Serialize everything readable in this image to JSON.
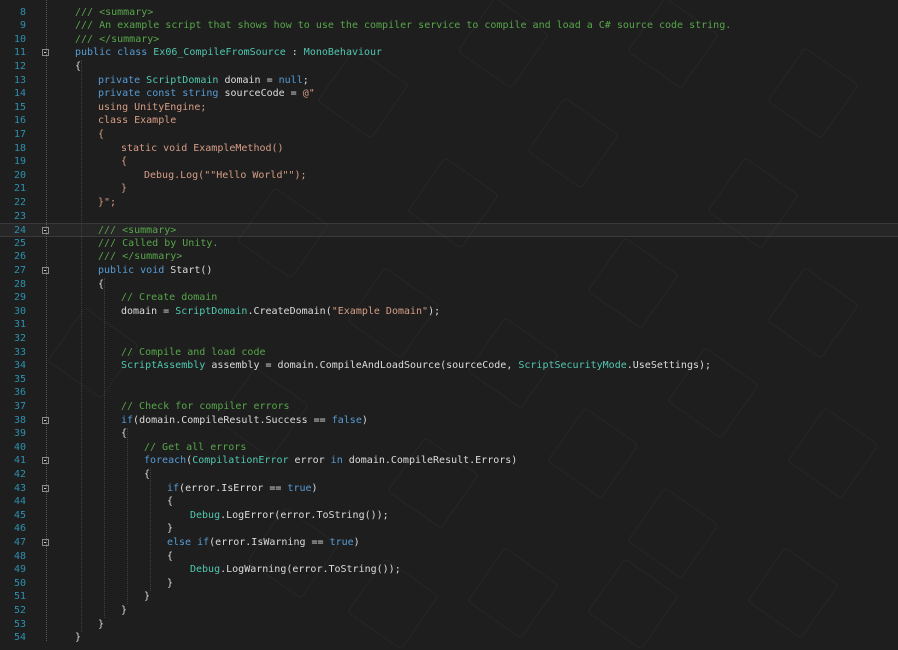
{
  "editor": {
    "lines": [
      {
        "num": "8",
        "fold": false,
        "indent": 0,
        "segments": [
          {
            "t": "/// <summary>",
            "c": "comment"
          }
        ]
      },
      {
        "num": "9",
        "fold": false,
        "indent": 0,
        "segments": [
          {
            "t": "/// An example script that shows how to use the compiler service to compile and load a C# source code string.",
            "c": "comment"
          }
        ]
      },
      {
        "num": "10",
        "fold": false,
        "indent": 0,
        "segments": [
          {
            "t": "/// </summary>",
            "c": "comment"
          }
        ]
      },
      {
        "num": "11",
        "fold": true,
        "indent": 0,
        "segments": [
          {
            "t": "public ",
            "c": "kw"
          },
          {
            "t": "class ",
            "c": "kw"
          },
          {
            "t": "Ex06_CompileFromSource",
            "c": "type"
          },
          {
            "t": " : ",
            "c": "text"
          },
          {
            "t": "MonoBehaviour",
            "c": "type"
          }
        ]
      },
      {
        "num": "12",
        "fold": false,
        "indent": 0,
        "segments": [
          {
            "t": "{",
            "c": "text"
          }
        ]
      },
      {
        "num": "13",
        "fold": false,
        "indent": 1,
        "segments": [
          {
            "t": "private ",
            "c": "kw"
          },
          {
            "t": "ScriptDomain",
            "c": "type"
          },
          {
            "t": " domain = ",
            "c": "text"
          },
          {
            "t": "null",
            "c": "kw"
          },
          {
            "t": ";",
            "c": "text"
          }
        ]
      },
      {
        "num": "14",
        "fold": false,
        "indent": 1,
        "segments": [
          {
            "t": "private ",
            "c": "kw"
          },
          {
            "t": "const ",
            "c": "kw"
          },
          {
            "t": "string ",
            "c": "kw"
          },
          {
            "t": "sourceCode = ",
            "c": "text"
          },
          {
            "t": "@\"",
            "c": "str"
          }
        ]
      },
      {
        "num": "15",
        "fold": false,
        "indent": 1,
        "segments": [
          {
            "t": "using UnityEngine;",
            "c": "str"
          }
        ]
      },
      {
        "num": "16",
        "fold": false,
        "indent": 1,
        "segments": [
          {
            "t": "class Example",
            "c": "str"
          }
        ]
      },
      {
        "num": "17",
        "fold": false,
        "indent": 1,
        "segments": [
          {
            "t": "{",
            "c": "str"
          }
        ]
      },
      {
        "num": "18",
        "fold": false,
        "indent": 2,
        "segments": [
          {
            "t": "static void ExampleMethod()",
            "c": "str"
          }
        ]
      },
      {
        "num": "19",
        "fold": false,
        "indent": 2,
        "segments": [
          {
            "t": "{",
            "c": "str"
          }
        ]
      },
      {
        "num": "20",
        "fold": false,
        "indent": 3,
        "segments": [
          {
            "t": "Debug.Log(\"\"Hello World\"\");",
            "c": "str"
          }
        ]
      },
      {
        "num": "21",
        "fold": false,
        "indent": 2,
        "segments": [
          {
            "t": "}",
            "c": "str"
          }
        ]
      },
      {
        "num": "22",
        "fold": false,
        "indent": 1,
        "segments": [
          {
            "t": "}\";",
            "c": "str"
          }
        ]
      },
      {
        "num": "23",
        "fold": false,
        "indent": 0,
        "segments": []
      },
      {
        "num": "24",
        "fold": true,
        "indent": 1,
        "current": true,
        "segments": [
          {
            "t": "/// <summary>",
            "c": "comment"
          }
        ]
      },
      {
        "num": "25",
        "fold": false,
        "indent": 1,
        "segments": [
          {
            "t": "/// Called by Unity.",
            "c": "comment"
          }
        ]
      },
      {
        "num": "26",
        "fold": false,
        "indent": 1,
        "segments": [
          {
            "t": "/// </summary>",
            "c": "comment"
          }
        ]
      },
      {
        "num": "27",
        "fold": true,
        "indent": 1,
        "segments": [
          {
            "t": "public ",
            "c": "kw"
          },
          {
            "t": "void ",
            "c": "kw"
          },
          {
            "t": "Start()",
            "c": "text"
          }
        ]
      },
      {
        "num": "28",
        "fold": false,
        "indent": 1,
        "segments": [
          {
            "t": "{",
            "c": "text"
          }
        ]
      },
      {
        "num": "29",
        "fold": false,
        "indent": 2,
        "segments": [
          {
            "t": "// Create domain",
            "c": "comment"
          }
        ]
      },
      {
        "num": "30",
        "fold": false,
        "indent": 2,
        "segments": [
          {
            "t": "domain = ",
            "c": "text"
          },
          {
            "t": "ScriptDomain",
            "c": "type"
          },
          {
            "t": ".CreateDomain(",
            "c": "text"
          },
          {
            "t": "\"Example Domain\"",
            "c": "str"
          },
          {
            "t": ");",
            "c": "text"
          }
        ]
      },
      {
        "num": "31",
        "fold": false,
        "indent": 0,
        "segments": []
      },
      {
        "num": "32",
        "fold": false,
        "indent": 0,
        "segments": []
      },
      {
        "num": "33",
        "fold": false,
        "indent": 2,
        "segments": [
          {
            "t": "// Compile and load code",
            "c": "comment"
          }
        ]
      },
      {
        "num": "34",
        "fold": false,
        "indent": 2,
        "segments": [
          {
            "t": "ScriptAssembly",
            "c": "type"
          },
          {
            "t": " assembly = domain.CompileAndLoadSource(sourceCode, ",
            "c": "text"
          },
          {
            "t": "ScriptSecurityMode",
            "c": "type"
          },
          {
            "t": ".UseSettings);",
            "c": "text"
          }
        ]
      },
      {
        "num": "35",
        "fold": false,
        "indent": 0,
        "segments": []
      },
      {
        "num": "36",
        "fold": false,
        "indent": 0,
        "segments": []
      },
      {
        "num": "37",
        "fold": false,
        "indent": 2,
        "segments": [
          {
            "t": "// Check for compiler errors",
            "c": "comment"
          }
        ]
      },
      {
        "num": "38",
        "fold": true,
        "indent": 2,
        "segments": [
          {
            "t": "if",
            "c": "kw"
          },
          {
            "t": "(domain.CompileResult.Success == ",
            "c": "text"
          },
          {
            "t": "false",
            "c": "kw"
          },
          {
            "t": ")",
            "c": "text"
          }
        ]
      },
      {
        "num": "39",
        "fold": false,
        "indent": 2,
        "segments": [
          {
            "t": "{",
            "c": "text"
          }
        ]
      },
      {
        "num": "40",
        "fold": false,
        "indent": 3,
        "segments": [
          {
            "t": "// Get all errors",
            "c": "comment"
          }
        ]
      },
      {
        "num": "41",
        "fold": true,
        "indent": 3,
        "segments": [
          {
            "t": "foreach",
            "c": "kw"
          },
          {
            "t": "(",
            "c": "text"
          },
          {
            "t": "CompilationError",
            "c": "type"
          },
          {
            "t": " error ",
            "c": "text"
          },
          {
            "t": "in ",
            "c": "kw"
          },
          {
            "t": "domain.CompileResult.Errors)",
            "c": "text"
          }
        ]
      },
      {
        "num": "42",
        "fold": false,
        "indent": 3,
        "segments": [
          {
            "t": "{",
            "c": "text"
          }
        ]
      },
      {
        "num": "43",
        "fold": true,
        "indent": 4,
        "segments": [
          {
            "t": "if",
            "c": "kw"
          },
          {
            "t": "(error.IsError == ",
            "c": "text"
          },
          {
            "t": "true",
            "c": "kw"
          },
          {
            "t": ")",
            "c": "text"
          }
        ]
      },
      {
        "num": "44",
        "fold": false,
        "indent": 4,
        "segments": [
          {
            "t": "{",
            "c": "text"
          }
        ]
      },
      {
        "num": "45",
        "fold": false,
        "indent": 5,
        "segments": [
          {
            "t": "Debug",
            "c": "type"
          },
          {
            "t": ".LogError(error.ToString());",
            "c": "text"
          }
        ]
      },
      {
        "num": "46",
        "fold": false,
        "indent": 4,
        "segments": [
          {
            "t": "}",
            "c": "text"
          }
        ]
      },
      {
        "num": "47",
        "fold": true,
        "indent": 4,
        "segments": [
          {
            "t": "else ",
            "c": "kw"
          },
          {
            "t": "if",
            "c": "kw"
          },
          {
            "t": "(error.IsWarning == ",
            "c": "text"
          },
          {
            "t": "true",
            "c": "kw"
          },
          {
            "t": ")",
            "c": "text"
          }
        ]
      },
      {
        "num": "48",
        "fold": false,
        "indent": 4,
        "segments": [
          {
            "t": "{",
            "c": "text"
          }
        ]
      },
      {
        "num": "49",
        "fold": false,
        "indent": 5,
        "segments": [
          {
            "t": "Debug",
            "c": "type"
          },
          {
            "t": ".LogWarning(error.ToString());",
            "c": "text"
          }
        ]
      },
      {
        "num": "50",
        "fold": false,
        "indent": 4,
        "segments": [
          {
            "t": "}",
            "c": "text"
          }
        ]
      },
      {
        "num": "51",
        "fold": false,
        "indent": 3,
        "segments": [
          {
            "t": "}",
            "c": "text"
          }
        ]
      },
      {
        "num": "52",
        "fold": false,
        "indent": 2,
        "segments": [
          {
            "t": "}",
            "c": "text"
          }
        ]
      },
      {
        "num": "53",
        "fold": false,
        "indent": 1,
        "segments": [
          {
            "t": "}",
            "c": "text"
          }
        ]
      },
      {
        "num": "54",
        "fold": false,
        "indent": 0,
        "segments": [
          {
            "t": "}",
            "c": "text"
          }
        ]
      }
    ]
  },
  "colors": {
    "background": "#1e1e1e",
    "line_number": "#2b91af",
    "comment": "#57a64a",
    "keyword": "#569cd6",
    "type": "#4ec9b0",
    "string": "#d69d85",
    "text": "#dcdcdc"
  }
}
